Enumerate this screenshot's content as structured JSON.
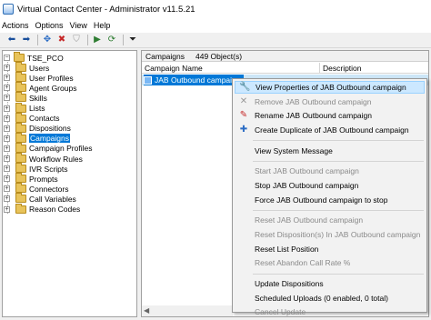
{
  "window": {
    "title": "Virtual Contact Center - Administrator v11.5.21"
  },
  "menubar": {
    "items": [
      "Actions",
      "Options",
      "View",
      "Help"
    ]
  },
  "toolbar": {
    "buttons": [
      {
        "name": "back-arrow-icon",
        "glyph": "⬅",
        "color": "#1a4f9c"
      },
      {
        "name": "forward-arrow-icon",
        "glyph": "➡",
        "color": "#1a4f9c"
      },
      {
        "name": "properties-icon",
        "glyph": "✥",
        "color": "#2b6cc4"
      },
      {
        "name": "delete-icon",
        "glyph": "✖",
        "color": "#c62828"
      },
      {
        "name": "shield-disabled-icon",
        "glyph": "⛉",
        "color": "#9e9e9e"
      },
      {
        "name": "run-icon",
        "glyph": "▶",
        "color": "#2e7d32"
      },
      {
        "name": "refresh-icon",
        "glyph": "⟳",
        "color": "#2e7d32"
      },
      {
        "name": "filter-icon",
        "glyph": "⏷",
        "color": "#222222"
      }
    ]
  },
  "tree": {
    "root": "TSE_PCO",
    "items": [
      "Users",
      "User Profiles",
      "Agent Groups",
      "Skills",
      "Lists",
      "Contacts",
      "Dispositions",
      "Campaigns",
      "Campaign Profiles",
      "Workflow Rules",
      "IVR Scripts",
      "Prompts",
      "Connectors",
      "Call Variables",
      "Reason Codes"
    ],
    "selected": "Campaigns"
  },
  "main": {
    "header_title": "Campaigns",
    "object_count": "449 Object(s)",
    "columns": [
      "Campaign Name",
      "Description"
    ],
    "rows": [
      {
        "name": "JAB Outbound campaign"
      }
    ]
  },
  "context_menu": {
    "items": [
      {
        "label": "View Properties of JAB Outbound campaign",
        "icon": "wrench-icon",
        "glyph": "🔧",
        "highlighted": true
      },
      {
        "label": "Remove JAB Outbound campaign",
        "icon": "remove-icon",
        "glyph": "✕",
        "disabled": true
      },
      {
        "label": "Rename JAB Outbound campaign",
        "icon": "rename-icon",
        "glyph": "✎"
      },
      {
        "label": "Create Duplicate of JAB Outbound campaign",
        "icon": "duplicate-icon",
        "glyph": "✚"
      },
      {
        "sep": true
      },
      {
        "label": "View System Message"
      },
      {
        "sep": true
      },
      {
        "label": "Start JAB Outbound campaign",
        "disabled": true
      },
      {
        "label": "Stop JAB Outbound campaign"
      },
      {
        "label": "Force JAB Outbound campaign to stop"
      },
      {
        "sep": true
      },
      {
        "label": "Reset JAB Outbound campaign",
        "disabled": true
      },
      {
        "label": "Reset Disposition(s) In JAB Outbound campaign",
        "disabled": true
      },
      {
        "label": "Reset List Position"
      },
      {
        "label": "Reset Abandon Call Rate %",
        "disabled": true
      },
      {
        "sep": true
      },
      {
        "label": "Update Dispositions"
      },
      {
        "label": "Scheduled Uploads (0 enabled, 0 total)"
      },
      {
        "label": "Cancel Update",
        "disabled": true
      }
    ]
  }
}
